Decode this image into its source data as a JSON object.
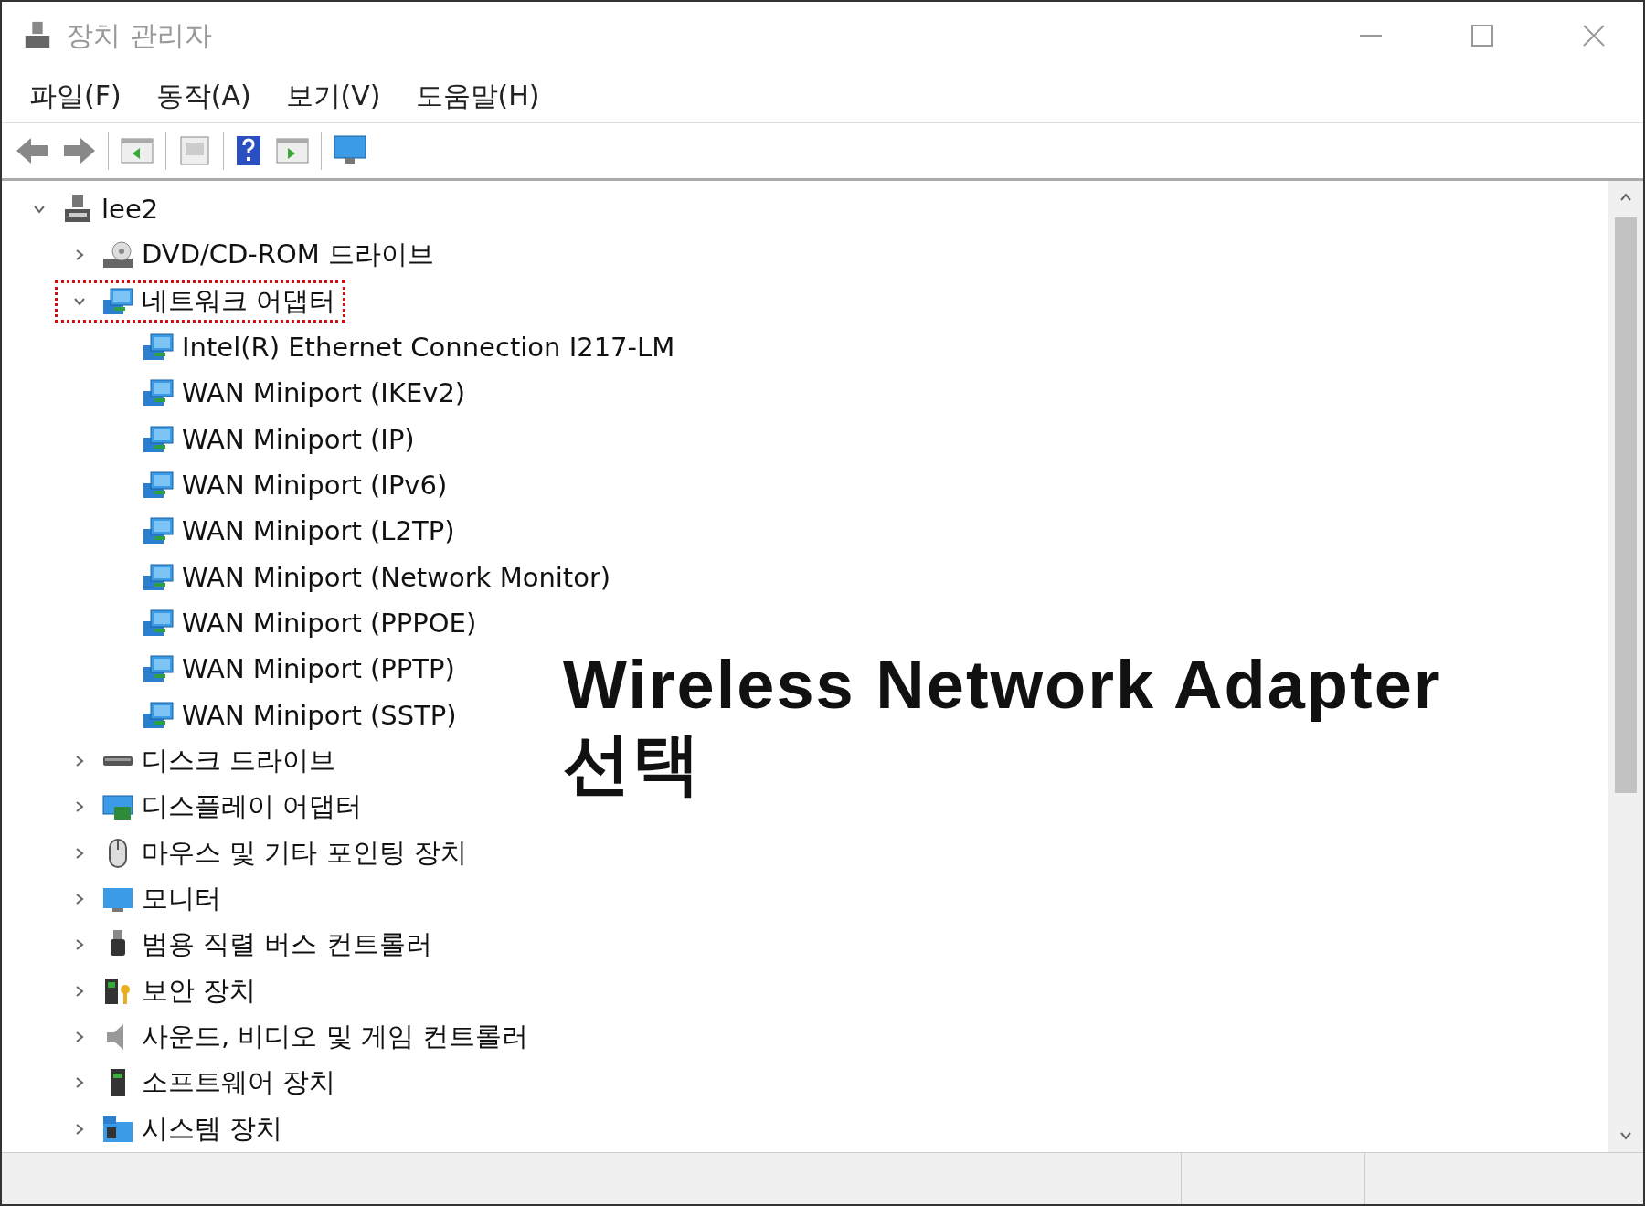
{
  "window": {
    "title": "장치 관리자"
  },
  "menu": [
    "파일(F)",
    "동작(A)",
    "보기(V)",
    "도움말(H)"
  ],
  "tree": [
    {
      "label": "lee2",
      "kind": "computer",
      "expanded": true,
      "marked": false,
      "children": [
        {
          "label": "DVD/CD-ROM 드라이브",
          "kind": "dvd",
          "expanded": false,
          "marked": false
        },
        {
          "label": "네트워크 어댑터",
          "kind": "network",
          "expanded": true,
          "marked": true,
          "children": [
            {
              "label": "Intel(R) Ethernet Connection I217-LM",
              "kind": "network"
            },
            {
              "label": "WAN Miniport (IKEv2)",
              "kind": "network"
            },
            {
              "label": "WAN Miniport (IP)",
              "kind": "network"
            },
            {
              "label": "WAN Miniport (IPv6)",
              "kind": "network"
            },
            {
              "label": "WAN Miniport (L2TP)",
              "kind": "network"
            },
            {
              "label": "WAN Miniport (Network Monitor)",
              "kind": "network"
            },
            {
              "label": "WAN Miniport (PPPOE)",
              "kind": "network"
            },
            {
              "label": "WAN Miniport (PPTP)",
              "kind": "network"
            },
            {
              "label": "WAN Miniport (SSTP)",
              "kind": "network"
            }
          ]
        },
        {
          "label": "디스크 드라이브",
          "kind": "disk",
          "expanded": false,
          "marked": false
        },
        {
          "label": "디스플레이 어댑터",
          "kind": "display",
          "expanded": false,
          "marked": false
        },
        {
          "label": "마우스 및 기타 포인팅 장치",
          "kind": "mouse",
          "expanded": false,
          "marked": false
        },
        {
          "label": "모니터",
          "kind": "monitor",
          "expanded": false,
          "marked": false
        },
        {
          "label": "범용 직렬 버스 컨트롤러",
          "kind": "usb",
          "expanded": false,
          "marked": false
        },
        {
          "label": "보안 장치",
          "kind": "security",
          "expanded": false,
          "marked": false
        },
        {
          "label": "사운드, 비디오 및 게임 컨트롤러",
          "kind": "sound",
          "expanded": false,
          "marked": false
        },
        {
          "label": "소프트웨어 장치",
          "kind": "software",
          "expanded": false,
          "marked": false
        },
        {
          "label": "시스템 장치",
          "kind": "system",
          "expanded": false,
          "marked": false
        }
      ]
    }
  ],
  "annotation": {
    "lines": [
      "Wireless Network Adapter",
      "선택"
    ]
  }
}
